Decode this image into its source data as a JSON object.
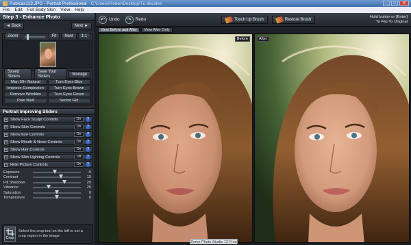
{
  "window": {
    "filename": "Robicas113.JPG",
    "title": "Portrait Professional",
    "path_text": "C:\\Users\\Rober\\Desktop\\Tu decides"
  },
  "menu": [
    "File",
    "Edit",
    "Full Body Skin",
    "View",
    "Help"
  ],
  "step": {
    "title": "Step 3 - Enhance Photo",
    "back_label": "Back",
    "next_label": "Next"
  },
  "zoom": {
    "label": "Zoom",
    "fit_label": "Fit",
    "next_label": "Next",
    "ratio_label": "1:1"
  },
  "saved_sliders": {
    "label": "Saved Sliders",
    "save_label": "Save Your Sliders",
    "manage_label": "Manage",
    "presets": [
      "Man 50+ Natural",
      "Turn Eyes Blue",
      "Improve Complexion",
      "Turn Eyes Brown",
      "Remove Wrinkles",
      "Turn Eyes Green",
      "Pale Waif",
      "Senior Girl"
    ]
  },
  "portrait_sliders": {
    "title": "Portrait Improving Sliders",
    "controls": [
      {
        "label": "Show Face Sculpt Controls",
        "state": "On"
      },
      {
        "label": "Show Skin Controls",
        "state": "On"
      },
      {
        "label": "Show Eye Controls",
        "state": "On"
      },
      {
        "label": "Show Mouth & Nose Controls",
        "state": "On"
      },
      {
        "label": "Show Hair Controls",
        "state": "On"
      },
      {
        "label": "Show Skin Lighting Controls",
        "state": "Off"
      },
      {
        "label": "Hide Picture Controls",
        "state": "On"
      }
    ]
  },
  "picture_controls": [
    {
      "name": "Exposure",
      "value": "-9",
      "level": 0.46
    },
    {
      "name": "Contrast",
      "value": "15",
      "level": 0.58
    },
    {
      "name": "Fill Shadows",
      "value": "29",
      "level": 0.65
    },
    {
      "name": "Vibrance",
      "value": "29",
      "level": 0.33
    },
    {
      "name": "Saturation",
      "value": "0",
      "level": 0.5
    },
    {
      "name": "Temperature",
      "value": "0",
      "level": 0.5
    }
  ],
  "crop": {
    "label": "Crop",
    "help_text": "Select the crop tool on the left to set a crop region in the image"
  },
  "toolbar": {
    "undo_label": "Undo",
    "redo_label": "Redo",
    "touch_up_label": "Touch Up Brush",
    "restore_label": "Restore Brush",
    "hold_text_1": "Hold button or [Enter]",
    "hold_text_2": "To Flip To Original"
  },
  "view_tabs": [
    "View Before and After",
    "View After Only"
  ],
  "panes": {
    "before_label": "Before",
    "after_label": "After"
  },
  "status": {
    "watermark": "Zoner Photo Studio 12 Free"
  },
  "colors": {
    "help_blue": "#3b66c8",
    "panel_bg": "#2a2e35",
    "title_blue": "#4f7fbf"
  }
}
